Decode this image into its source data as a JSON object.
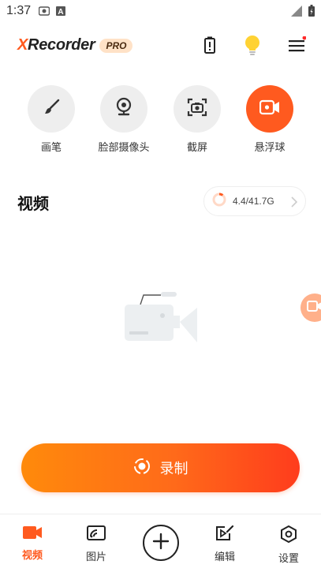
{
  "status_bar": {
    "time": "1:37",
    "icons_left": [
      "screen-record-icon",
      "a-notification-icon"
    ],
    "icons_right": [
      "signal-icon",
      "battery-icon"
    ]
  },
  "header": {
    "logo_x": "X",
    "logo_rest": "Recorder",
    "pro_badge": "PRO",
    "icons": [
      "battery-saver-icon",
      "lightbulb-icon",
      "menu-icon"
    ],
    "menu_has_notification_dot": true
  },
  "tools": [
    {
      "label": "画笔",
      "icon": "brush-icon",
      "active": false
    },
    {
      "label": "脸部摄像头",
      "icon": "webcam-icon",
      "active": false
    },
    {
      "label": "截屏",
      "icon": "screenshot-icon",
      "active": false
    },
    {
      "label": "悬浮球",
      "icon": "floating-ball-icon",
      "active": true
    }
  ],
  "video_section": {
    "title": "视频",
    "storage_text": "4.4/41.7G",
    "storage_used_fraction": 0.105
  },
  "record_button": {
    "label": "录制"
  },
  "bottom_nav": [
    {
      "label": "视频",
      "icon": "video-icon",
      "active": true
    },
    {
      "label": "图片",
      "icon": "image-icon",
      "active": false
    },
    {
      "label": "",
      "icon": "add-icon",
      "active": false
    },
    {
      "label": "编辑",
      "icon": "edit-video-icon",
      "active": false
    },
    {
      "label": "设置",
      "icon": "settings-icon",
      "active": false
    }
  ],
  "colors": {
    "accent": "#ff5a1f",
    "gradient_start": "#ff8a0b",
    "gradient_end": "#ff3c1c",
    "tool_bg": "#eeeeee"
  }
}
